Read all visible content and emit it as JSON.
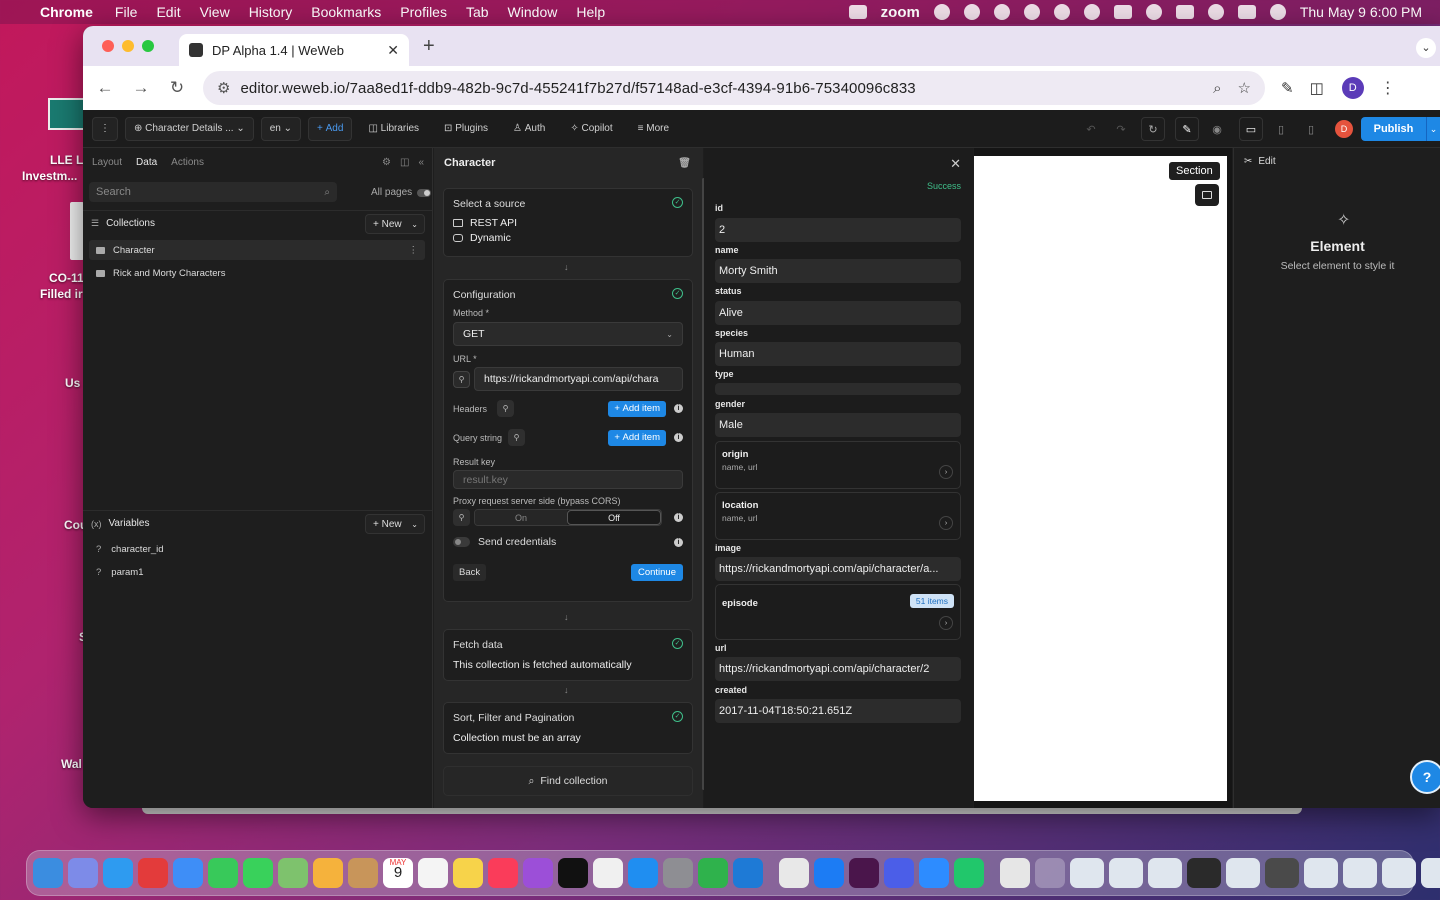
{
  "menubar": {
    "app": "Chrome",
    "items": [
      "File",
      "Edit",
      "View",
      "History",
      "Bookmarks",
      "Profiles",
      "Tab",
      "Window",
      "Help"
    ],
    "zoom_label": "zoom",
    "clock": "Thu May 9  6:00 PM"
  },
  "desktop": {
    "labels": [
      "LLE L",
      "Investm...",
      "CO-11",
      "Filled ir",
      "Us",
      "Cou",
      "S",
      "Wal"
    ]
  },
  "browser": {
    "tab_title": "DP Alpha 1.4 | WeWeb",
    "url": "editor.weweb.io/7aa8ed1f-ddb9-482b-9c7d-455241f7b27d/f57148ad-e3cf-4394-91b6-75340096c833",
    "profile_initial": "D"
  },
  "toolbar": {
    "page_select": "Character Details ...",
    "lang": "en",
    "add": "Add",
    "libraries": "Libraries",
    "plugins": "Plugins",
    "auth": "Auth",
    "copilot": "Copilot",
    "more": "More",
    "avatar": "D",
    "publish": "Publish"
  },
  "left": {
    "tabs": [
      "Layout",
      "Data",
      "Actions"
    ],
    "search_placeholder": "Search",
    "all_pages": "All pages",
    "collections_title": "Collections",
    "new_label": "New",
    "collections": [
      "Character",
      "Rick and Morty Characters"
    ],
    "variables_title": "Variables",
    "variables": [
      "character_id",
      "param1"
    ]
  },
  "config": {
    "title": "Character",
    "source_title": "Select a source",
    "source_type": "REST API",
    "source_mode": "Dynamic",
    "configuration_title": "Configuration",
    "method_label": "Method *",
    "method_value": "GET",
    "url_label": "URL *",
    "url_value": "https://rickandmortyapi.com/api/chara",
    "headers_label": "Headers",
    "query_label": "Query string",
    "add_item": "Add item",
    "result_key_label": "Result key",
    "result_key_placeholder": "result.key",
    "proxy_label": "Proxy request server side (bypass CORS)",
    "proxy_on": "On",
    "proxy_off": "Off",
    "send_credentials": "Send credentials",
    "back": "Back",
    "continue": "Continue",
    "fetch_title": "Fetch data",
    "fetch_desc": "This collection is fetched automatically",
    "sort_title": "Sort, Filter and Pagination",
    "sort_desc": "Collection must be an array",
    "find_collection": "Find collection"
  },
  "result": {
    "status": "Success",
    "fields": [
      {
        "label": "id",
        "value": "2"
      },
      {
        "label": "name",
        "value": "Morty Smith"
      },
      {
        "label": "status",
        "value": "Alive"
      },
      {
        "label": "species",
        "value": "Human"
      },
      {
        "label": "type",
        "value": ""
      },
      {
        "label": "gender",
        "value": "Male"
      }
    ],
    "origin": {
      "title": "origin",
      "sub": "name, url"
    },
    "location": {
      "title": "location",
      "sub": "name, url"
    },
    "image_label": "image",
    "image_value": "https://rickandmortyapi.com/api/character/a...",
    "episode_title": "episode",
    "episode_badge": "51 items",
    "url_label": "url",
    "url_value": "https://rickandmortyapi.com/api/character/2",
    "created_label": "created",
    "created_value": "2017-11-04T18:50:21.651Z"
  },
  "canvas": {
    "section_tag": "Section"
  },
  "style_panel": {
    "edit": "Edit",
    "title": "Element",
    "subtitle": "Select element to style it"
  },
  "dock": {
    "calendar_month": "MAY",
    "calendar_day": "9"
  },
  "colors": {
    "accent": "#1e88e5",
    "success": "#3fbf8a",
    "panel_bg": "#1e1e1e"
  }
}
